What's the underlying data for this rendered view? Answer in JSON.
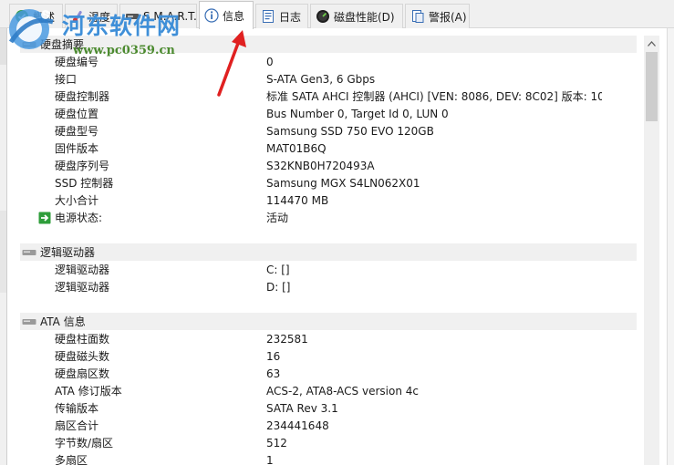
{
  "watermark": {
    "title": "河东软件网",
    "url": "www.pc0359.cn"
  },
  "tabs": [
    {
      "label": "概述",
      "icon": "check-shield-icon"
    },
    {
      "label": "温度",
      "icon": "thermometer-icon"
    },
    {
      "label": "S.M.A.R.T.",
      "icon": "smart-icon"
    },
    {
      "label": "信息",
      "icon": "info-icon",
      "active": true
    },
    {
      "label": "日志",
      "icon": "log-icon"
    },
    {
      "label": "磁盘性能(D)",
      "icon": "gauge-icon"
    },
    {
      "label": "警报(A)",
      "icon": "alert-document-icon"
    }
  ],
  "sections": [
    {
      "title": "硬盘摘要",
      "rows": [
        {
          "key": "硬盘编号",
          "value": "0"
        },
        {
          "key": "接口",
          "value": "S-ATA Gen3, 6 Gbps"
        },
        {
          "key": "硬盘控制器",
          "value": "标准 SATA AHCI 控制器 (AHCI) [VEN: 8086, DEV: 8C02] 版本: 10.0...."
        },
        {
          "key": "硬盘位置",
          "value": "Bus Number 0, Target Id 0, LUN 0"
        },
        {
          "key": "硬盘型号",
          "value": "Samsung SSD 750 EVO 120GB"
        },
        {
          "key": "固件版本",
          "value": "MAT01B6Q"
        },
        {
          "key": "硬盘序列号",
          "value": "S32KNB0H720493A"
        },
        {
          "key": "SSD 控制器",
          "value": "Samsung MGX S4LN062X01"
        },
        {
          "key": "大小合计",
          "value": "114470 MB"
        },
        {
          "key": "电源状态:",
          "value": "活动",
          "icon": "power-arrow-icon"
        }
      ]
    },
    {
      "title": "逻辑驱动器",
      "rows": [
        {
          "key": "逻辑驱动器",
          "value": "C: []"
        },
        {
          "key": "逻辑驱动器",
          "value": "D: []"
        }
      ]
    },
    {
      "title": "ATA 信息",
      "rows": [
        {
          "key": "硬盘柱面数",
          "value": "232581"
        },
        {
          "key": "硬盘磁头数",
          "value": "16"
        },
        {
          "key": "硬盘扇区数",
          "value": "63"
        },
        {
          "key": "ATA 修订版本",
          "value": "ACS-2, ATA8-ACS version 4c"
        },
        {
          "key": "传输版本",
          "value": "SATA Rev 3.1"
        },
        {
          "key": "扇区合计",
          "value": "234441648"
        },
        {
          "key": "字节数/扇区",
          "value": "512"
        },
        {
          "key": "多扇区",
          "value": "1"
        }
      ]
    }
  ],
  "colors": {
    "annotation_arrow": "#e02020",
    "watermark_blue": "#3f8fd8",
    "watermark_green": "#4b8a2f",
    "section_bg": "#f0f0f0",
    "power_icon_green": "#2e9d3a"
  }
}
